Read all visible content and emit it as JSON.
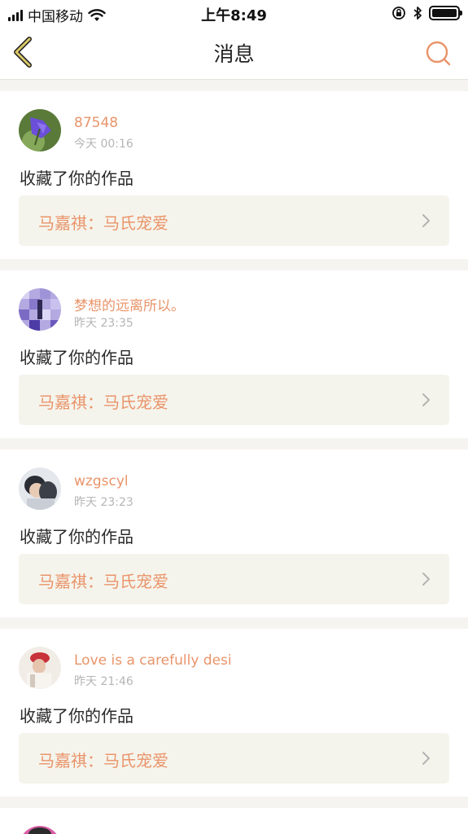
{
  "status_bar": {
    "carrier": "中国移动",
    "time": "上午8:49",
    "icons": [
      "signal-icon",
      "wifi-icon",
      "orientation-lock-icon",
      "bluetooth-icon",
      "battery-icon"
    ]
  },
  "nav": {
    "title": "消息",
    "back_icon": "chevron-left-icon",
    "search_icon": "search-icon",
    "accent_color": "#e9946a"
  },
  "messages": [
    {
      "username": "87548",
      "time": "今天 00:16",
      "action": "收藏了你的作品",
      "work_title": "马嘉祺：马氏宠爱"
    },
    {
      "username": "梦想的远离所以。",
      "time": "昨天 23:35",
      "action": "收藏了你的作品",
      "work_title": "马嘉祺：马氏宠爱"
    },
    {
      "username": "wzgscyl",
      "time": "昨天 23:23",
      "action": "收藏了你的作品",
      "work_title": "马嘉祺：马氏宠爱"
    },
    {
      "username": "Love is a carefully desi",
      "time": "昨天 21:46",
      "action": "收藏了你的作品",
      "work_title": "马嘉祺：马氏宠爱"
    }
  ]
}
